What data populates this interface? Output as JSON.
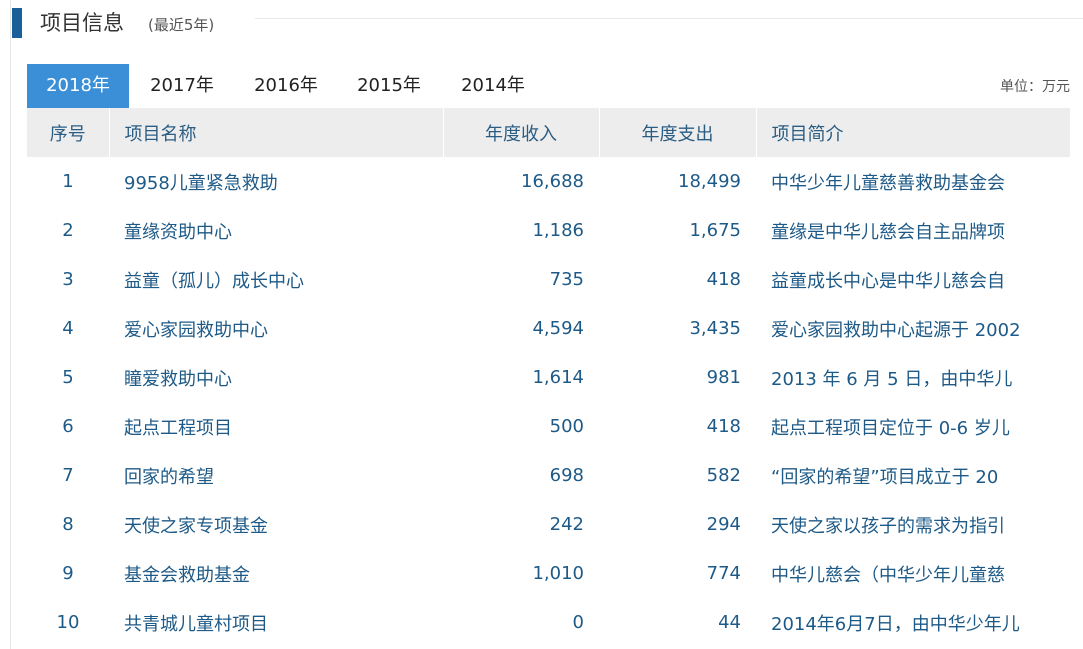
{
  "header": {
    "title": "项目信息",
    "subtitle": "(最近5年)"
  },
  "tabs": [
    {
      "label": "2018年",
      "active": true
    },
    {
      "label": "2017年",
      "active": false
    },
    {
      "label": "2016年",
      "active": false
    },
    {
      "label": "2015年",
      "active": false
    },
    {
      "label": "2014年",
      "active": false
    }
  ],
  "unit_label": "单位：万元",
  "table": {
    "columns": [
      "序号",
      "项目名称",
      "年度收入",
      "年度支出",
      "项目简介"
    ],
    "rows": [
      [
        "1",
        "9958儿童紧急救助",
        "16,688",
        "18,499",
        "中华少年儿童慈善救助基金会"
      ],
      [
        "2",
        "童缘资助中心",
        "1,186",
        "1,675",
        "童缘是中华儿慈会自主品牌项"
      ],
      [
        "3",
        "益童（孤儿）成长中心",
        "735",
        "418",
        "益童成长中心是中华儿慈会自"
      ],
      [
        "4",
        "爱心家园救助中心",
        "4,594",
        "3,435",
        "爱心家园救助中心起源于 2002"
      ],
      [
        "5",
        "瞳爱救助中心",
        "1,614",
        "981",
        "2013 年 6 月 5 日，由中华儿"
      ],
      [
        "6",
        "起点工程项目",
        "500",
        "418",
        "起点工程项目定位于 0-6 岁儿"
      ],
      [
        "7",
        "回家的希望",
        "698",
        "582",
        "“回家的希望”项目成立于 20"
      ],
      [
        "8",
        "天使之家专项基金",
        "242",
        "294",
        "天使之家以孩子的需求为指引"
      ],
      [
        "9",
        "基金会救助基金",
        "1,010",
        "774",
        "中华儿慈会（中华少年儿童慈"
      ],
      [
        "10",
        "共青城儿童村项目",
        "0",
        "44",
        "2014年6月7日，由中华少年儿"
      ]
    ]
  }
}
